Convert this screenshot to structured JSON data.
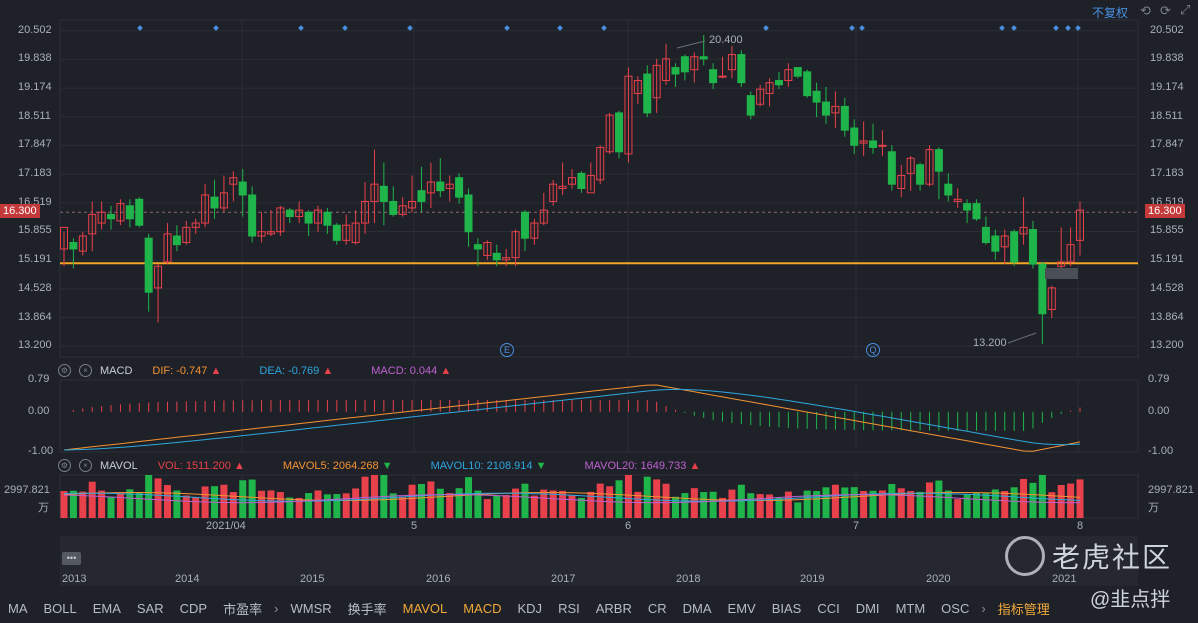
{
  "header": {
    "adjust_label": "不复权",
    "tool_icons": [
      "undo-icon",
      "redo-icon",
      "fullscreen-icon"
    ]
  },
  "price_axis": {
    "ticks": [
      "20.502",
      "19.838",
      "19.174",
      "18.511",
      "17.847",
      "17.183",
      "16.519",
      "15.855",
      "15.191",
      "14.528",
      "13.864",
      "13.200"
    ],
    "current_price": "16.300",
    "max_label": "20.400",
    "min_label": "13.200"
  },
  "event_markers": [
    "E",
    "Q"
  ],
  "macd": {
    "name": "MACD",
    "dif_label": "DIF: -0.747",
    "dea_label": "DEA: -0.769",
    "macd_label": "MACD: 0.044",
    "ticks": [
      "0.79",
      "0.00",
      "-1.00"
    ]
  },
  "mavol": {
    "name": "MAVOL",
    "vol_label": "VOL: 1511.200",
    "mavol5_label": "MAVOL5: 2064.268",
    "mavol10_label": "MAVOL10: 2108.914",
    "mavol20_label": "MAVOL20: 1649.733",
    "top_tick": "2997.821",
    "unit": "万"
  },
  "time_axis": [
    "2021/04",
    "5",
    "6",
    "7",
    "8"
  ],
  "overview_years": [
    "2013",
    "2014",
    "2015",
    "2016",
    "2017",
    "2018",
    "2019",
    "2020",
    "2021"
  ],
  "tabs": [
    "MA",
    "BOLL",
    "EMA",
    "SAR",
    "CDP",
    "市盈率",
    "WMSR",
    "换手率",
    "MAVOL",
    "MACD",
    "KDJ",
    "RSI",
    "ARBR",
    "CR",
    "DMA",
    "EMV",
    "BIAS",
    "CCI",
    "DMI",
    "MTM",
    "OSC",
    "指标管理"
  ],
  "active_tabs": [
    "MAVOL",
    "MACD"
  ],
  "watermark": {
    "brand": "老虎社区",
    "author": "@韭点拌"
  },
  "colors": {
    "up": "#e8414b",
    "down": "#1fb54a",
    "support_line": "#f5a623",
    "dif": "#f59331",
    "dea": "#2ea7e0",
    "macd": "#c060d0",
    "mavol10": "#2ea7e0",
    "mavol20": "#c060d0",
    "background": "#1e2127"
  },
  "chart_data": {
    "type": "candlestick",
    "support_level": 15.12,
    "y_range": [
      12.95,
      20.75
    ],
    "candles": [
      [
        15.45,
        15.95,
        15.05,
        15.85
      ],
      [
        15.6,
        15.45,
        15.0,
        15.7
      ],
      [
        15.4,
        15.75,
        15.3,
        15.85
      ],
      [
        15.8,
        16.25,
        15.4,
        16.55
      ],
      [
        16.05,
        16.3,
        15.9,
        16.55
      ],
      [
        16.25,
        16.15,
        15.9,
        16.45
      ],
      [
        16.1,
        16.5,
        16.0,
        16.6
      ],
      [
        16.45,
        16.15,
        15.95,
        16.6
      ],
      [
        16.6,
        16.0,
        15.95,
        16.65
      ],
      [
        15.7,
        14.45,
        14.0,
        15.8
      ],
      [
        14.55,
        15.05,
        13.75,
        15.1
      ],
      [
        15.15,
        15.8,
        15.1,
        16.05
      ],
      [
        15.75,
        15.55,
        15.4,
        16.0
      ],
      [
        15.6,
        15.95,
        15.55,
        16.1
      ],
      [
        15.95,
        16.05,
        15.8,
        16.15
      ],
      [
        16.05,
        16.7,
        15.95,
        16.95
      ],
      [
        16.65,
        16.4,
        16.15,
        17.05
      ],
      [
        16.4,
        16.75,
        16.3,
        17.15
      ],
      [
        16.95,
        17.1,
        16.55,
        17.25
      ],
      [
        17.0,
        16.7,
        16.2,
        17.3
      ],
      [
        16.7,
        15.75,
        15.6,
        16.9
      ],
      [
        15.75,
        15.85,
        15.6,
        16.3
      ],
      [
        15.8,
        15.85,
        15.75,
        16.35
      ],
      [
        15.85,
        16.4,
        15.75,
        16.45
      ],
      [
        16.35,
        16.2,
        16.05,
        16.4
      ],
      [
        16.2,
        16.35,
        16.05,
        16.55
      ],
      [
        16.3,
        16.05,
        15.75,
        16.35
      ],
      [
        16.05,
        16.35,
        15.85,
        16.45
      ],
      [
        16.3,
        16.0,
        15.8,
        16.4
      ],
      [
        16.0,
        15.65,
        15.55,
        16.05
      ],
      [
        15.65,
        16.0,
        15.55,
        16.25
      ],
      [
        15.6,
        16.05,
        15.55,
        16.35
      ],
      [
        16.05,
        16.55,
        15.8,
        17.0
      ],
      [
        16.55,
        16.95,
        16.05,
        17.75
      ],
      [
        16.9,
        16.55,
        16.0,
        17.45
      ],
      [
        16.55,
        16.25,
        16.2,
        16.9
      ],
      [
        16.25,
        16.45,
        16.2,
        16.65
      ],
      [
        16.4,
        16.55,
        16.3,
        17.15
      ],
      [
        16.8,
        16.55,
        16.3,
        17.35
      ],
      [
        16.75,
        17.0,
        16.4,
        17.45
      ],
      [
        17.0,
        16.8,
        16.65,
        17.55
      ],
      [
        16.85,
        16.95,
        16.55,
        17.15
      ],
      [
        17.1,
        16.65,
        16.5,
        17.2
      ],
      [
        16.7,
        15.85,
        15.5,
        16.85
      ],
      [
        15.55,
        15.45,
        15.05,
        15.7
      ],
      [
        15.3,
        15.6,
        15.2,
        15.65
      ],
      [
        15.35,
        15.2,
        15.05,
        15.55
      ],
      [
        15.2,
        15.25,
        15.05,
        15.45
      ],
      [
        15.25,
        15.85,
        15.05,
        15.9
      ],
      [
        16.3,
        15.7,
        15.4,
        16.35
      ],
      [
        15.7,
        16.05,
        15.55,
        16.15
      ],
      [
        16.05,
        16.35,
        16.0,
        16.75
      ],
      [
        16.55,
        16.95,
        16.45,
        17.05
      ],
      [
        16.85,
        16.9,
        16.7,
        17.45
      ],
      [
        16.95,
        17.1,
        16.85,
        17.3
      ],
      [
        17.2,
        16.85,
        16.75,
        17.25
      ],
      [
        16.75,
        17.15,
        16.8,
        17.45
      ],
      [
        17.05,
        17.8,
        16.95,
        17.85
      ],
      [
        17.7,
        18.55,
        17.65,
        18.6
      ],
      [
        18.6,
        17.7,
        17.55,
        18.65
      ],
      [
        17.65,
        19.45,
        17.45,
        19.65
      ],
      [
        19.05,
        19.35,
        18.8,
        19.45
      ],
      [
        19.5,
        18.6,
        18.5,
        19.7
      ],
      [
        18.95,
        19.7,
        18.6,
        19.85
      ],
      [
        19.35,
        19.85,
        19.25,
        20.2
      ],
      [
        19.65,
        19.5,
        19.2,
        19.75
      ],
      [
        19.9,
        19.55,
        19.35,
        19.95
      ],
      [
        19.6,
        19.9,
        19.3,
        20.0
      ],
      [
        19.9,
        19.85,
        19.7,
        20.4
      ],
      [
        19.6,
        19.3,
        19.15,
        19.75
      ],
      [
        19.45,
        19.45,
        19.4,
        19.9
      ],
      [
        19.6,
        19.95,
        19.4,
        20.15
      ],
      [
        19.95,
        19.3,
        19.2,
        20.05
      ],
      [
        19.0,
        18.55,
        18.45,
        19.1
      ],
      [
        18.8,
        19.15,
        18.75,
        19.25
      ],
      [
        19.05,
        19.3,
        18.75,
        19.4
      ],
      [
        19.35,
        19.25,
        19.15,
        19.55
      ],
      [
        19.35,
        19.6,
        19.2,
        19.75
      ],
      [
        19.65,
        19.45,
        19.4,
        19.65
      ],
      [
        19.55,
        19.0,
        18.95,
        19.6
      ],
      [
        19.1,
        18.85,
        18.5,
        19.3
      ],
      [
        18.85,
        18.55,
        18.35,
        19.2
      ],
      [
        18.6,
        18.75,
        18.25,
        19.1
      ],
      [
        18.75,
        18.2,
        18.05,
        18.95
      ],
      [
        18.25,
        17.85,
        17.65,
        18.45
      ],
      [
        17.9,
        17.95,
        17.6,
        18.4
      ],
      [
        17.95,
        17.8,
        17.65,
        18.35
      ],
      [
        17.85,
        17.85,
        17.6,
        18.2
      ],
      [
        17.7,
        16.95,
        16.8,
        17.85
      ],
      [
        16.85,
        17.15,
        16.65,
        17.4
      ],
      [
        17.2,
        17.55,
        16.8,
        17.6
      ],
      [
        17.4,
        16.95,
        16.8,
        17.45
      ],
      [
        16.95,
        17.75,
        16.9,
        17.85
      ],
      [
        17.75,
        17.25,
        16.6,
        17.8
      ],
      [
        16.95,
        16.7,
        16.55,
        17.2
      ],
      [
        16.55,
        16.6,
        16.4,
        16.85
      ],
      [
        16.5,
        16.35,
        16.05,
        16.6
      ],
      [
        16.5,
        16.15,
        16.1,
        16.6
      ],
      [
        15.95,
        15.6,
        15.55,
        16.2
      ],
      [
        15.75,
        15.4,
        15.2,
        15.9
      ],
      [
        15.5,
        15.75,
        15.1,
        15.9
      ],
      [
        15.85,
        15.15,
        15.05,
        15.9
      ],
      [
        15.8,
        15.95,
        15.55,
        16.65
      ],
      [
        15.9,
        15.1,
        15.0,
        16.1
      ],
      [
        15.1,
        13.95,
        13.25,
        15.15
      ],
      [
        14.05,
        14.55,
        13.85,
        14.6
      ],
      [
        15.05,
        15.15,
        15.0,
        15.95
      ],
      [
        15.15,
        15.55,
        15.05,
        15.95
      ],
      [
        15.65,
        16.35,
        15.3,
        16.55
      ]
    ],
    "macd": {
      "dif_last": -0.747,
      "dea_last": -0.769,
      "macd_last": 0.044,
      "range": [
        -1.0,
        0.79
      ]
    },
    "volume": {
      "vol_last": 1511.2,
      "mavol5_last": 2064.268,
      "mavol10_last": 2108.914,
      "mavol20_last": 1649.733,
      "max": 2997.821,
      "unit": "万"
    }
  }
}
